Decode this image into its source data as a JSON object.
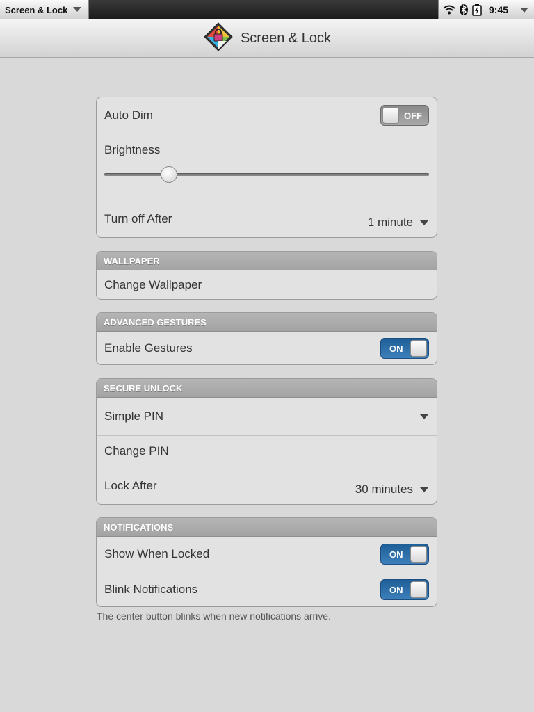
{
  "status_bar": {
    "app_menu_label": "Screen & Lock",
    "time": "9:45",
    "icons": [
      "wifi-icon",
      "bluetooth-icon",
      "battery-charging-icon"
    ]
  },
  "header": {
    "title": "Screen & Lock",
    "icon": "screen-lock-app-icon"
  },
  "display": {
    "auto_dim": {
      "label": "Auto Dim",
      "state": "OFF"
    },
    "brightness": {
      "label": "Brightness",
      "value_fraction": 0.2
    },
    "turn_off_after": {
      "label": "Turn off After",
      "value": "1 minute"
    }
  },
  "wallpaper": {
    "header": "WALLPAPER",
    "change_label": "Change Wallpaper"
  },
  "advanced_gestures": {
    "header": "ADVANCED GESTURES",
    "enable_label": "Enable Gestures",
    "state": "ON"
  },
  "secure_unlock": {
    "header": "SECURE UNLOCK",
    "mode": "Simple PIN",
    "change_pin_label": "Change PIN",
    "lock_after": {
      "label": "Lock After",
      "value": "30 minutes"
    }
  },
  "notifications": {
    "header": "NOTIFICATIONS",
    "show_when_locked": {
      "label": "Show When Locked",
      "state": "ON"
    },
    "blink": {
      "label": "Blink Notifications",
      "state": "ON"
    },
    "footnote": "The center button blinks when new notifications arrive."
  },
  "colors": {
    "toggle_on": "#2f6fad",
    "toggle_off": "#999999",
    "background": "#d9d9d9"
  }
}
